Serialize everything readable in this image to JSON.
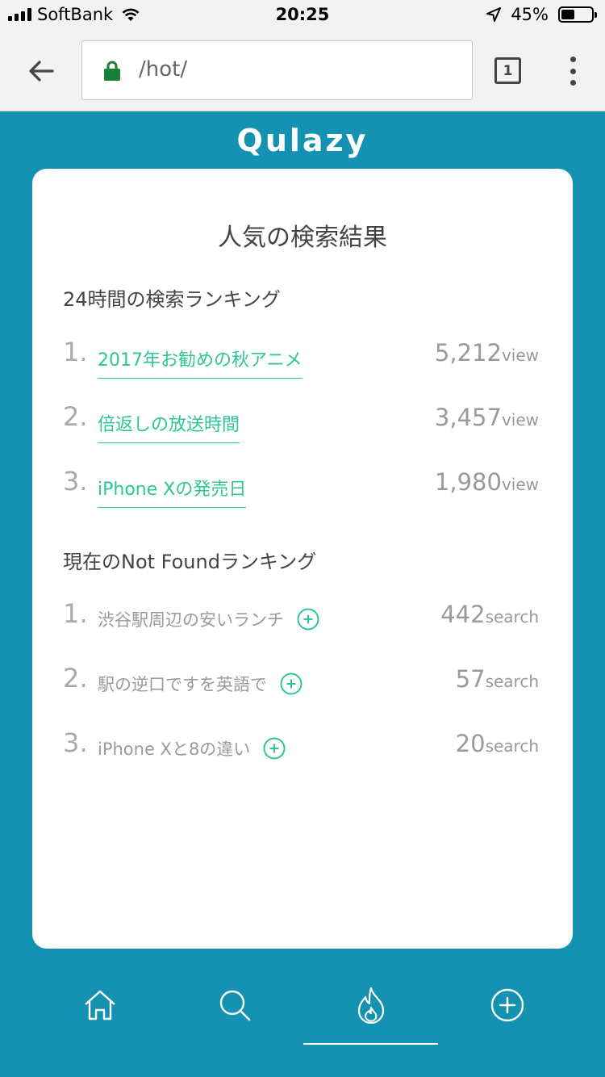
{
  "status_bar": {
    "carrier": "SoftBank",
    "time": "20:25",
    "battery": "45%",
    "battery_level": 0.45,
    "icons": [
      "signal-icon",
      "wifi-icon",
      "location-arrow-icon",
      "battery-icon"
    ]
  },
  "browser": {
    "url": "/hot/",
    "tab_count": "1",
    "icons": [
      "back-arrow-icon",
      "lock-icon",
      "tabs-icon",
      "menu-icon"
    ]
  },
  "app": {
    "logo": "Qulazy",
    "colors": {
      "brand": "#1592b1",
      "accent": "#2fc695",
      "muted": "#9a9a9a"
    }
  },
  "card": {
    "title": "人気の検索結果",
    "search_ranking": {
      "title": "24時間の検索ランキング",
      "items": [
        {
          "rank": "1.",
          "term": "2017年お勧めの秋アニメ",
          "value": "5,212",
          "unit": "view"
        },
        {
          "rank": "2.",
          "term": "倍返しの放送時間",
          "value": "3,457",
          "unit": "view"
        },
        {
          "rank": "3.",
          "term": "iPhone Xの発売日",
          "value": "1,980",
          "unit": "view"
        }
      ]
    },
    "not_found_ranking": {
      "title": "現在のNot Foundランキング",
      "items": [
        {
          "rank": "1.",
          "term": "渋谷駅周辺の安いランチ",
          "value": "442",
          "unit": "search"
        },
        {
          "rank": "2.",
          "term": "駅の逆口ですを英語で",
          "value": "57",
          "unit": "search"
        },
        {
          "rank": "3.",
          "term": "iPhone Xと8の違い",
          "value": "20",
          "unit": "search"
        }
      ]
    }
  },
  "bottom_nav": {
    "items": [
      "home-icon",
      "search-icon",
      "fire-icon",
      "add-icon"
    ],
    "active": "fire-icon"
  }
}
